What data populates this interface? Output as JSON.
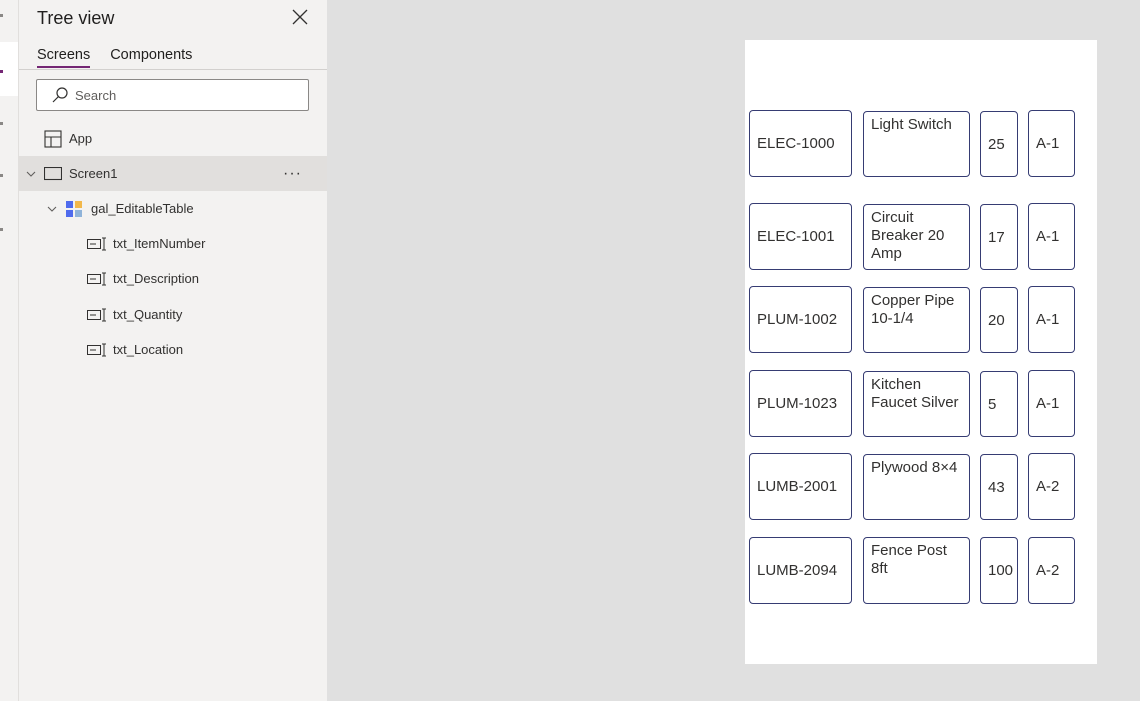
{
  "tree_view": {
    "title": "Tree view",
    "close_icon": "close-icon",
    "tabs": [
      {
        "label": "Screens",
        "active": true
      },
      {
        "label": "Components",
        "active": false
      }
    ],
    "search": {
      "placeholder": "Search",
      "value": ""
    },
    "items": [
      {
        "label": "App",
        "icon": "app-icon"
      },
      {
        "label": "Screen1",
        "icon": "screen-icon",
        "selected": true,
        "expanded": true
      },
      {
        "label": "gal_EditableTable",
        "icon": "gallery-icon",
        "expanded": true
      },
      {
        "label": "txt_ItemNumber",
        "icon": "text-input-icon"
      },
      {
        "label": "txt_Description",
        "icon": "text-input-icon"
      },
      {
        "label": "txt_Quantity",
        "icon": "text-input-icon"
      },
      {
        "label": "txt_Location",
        "icon": "text-input-icon"
      }
    ]
  },
  "gallery": {
    "rows": [
      {
        "item_number": "ELEC-1000",
        "description": "Light Switch",
        "quantity": "25",
        "location": "A-1"
      },
      {
        "item_number": "ELEC-1001",
        "description": "Circuit Breaker 20 Amp",
        "quantity": "17",
        "location": "A-1"
      },
      {
        "item_number": "PLUM-1002",
        "description": "Copper Pipe 10-1/4",
        "quantity": "20",
        "location": "A-1"
      },
      {
        "item_number": "PLUM-1023",
        "description": "Kitchen Faucet Silver",
        "quantity": "5",
        "location": "A-1"
      },
      {
        "item_number": "LUMB-2001",
        "description": "Plywood 8×4",
        "quantity": "43",
        "location": "A-2"
      },
      {
        "item_number": "LUMB-2094",
        "description": "Fence Post 8ft",
        "quantity": "100",
        "location": "A-2"
      }
    ]
  },
  "colors": {
    "accent": "#742774",
    "input_border": "#363c73",
    "canvas_bg": "#e0e0e0",
    "panel_bg": "#f3f2f1"
  }
}
